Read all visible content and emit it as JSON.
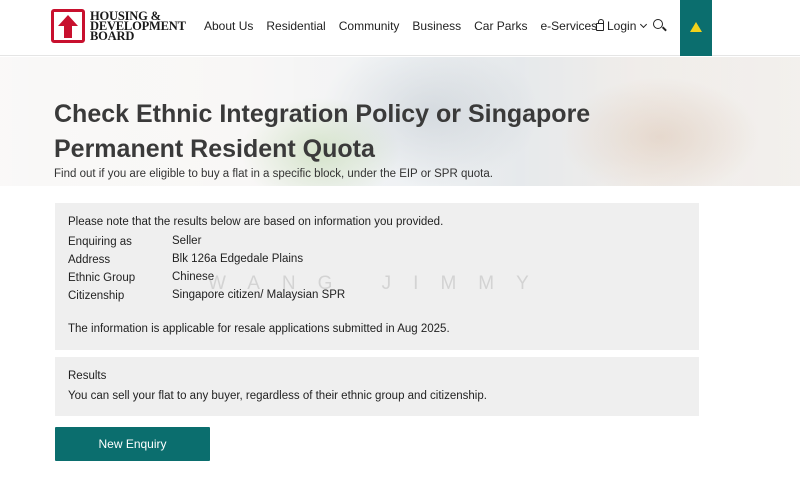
{
  "header": {
    "logo_lines": [
      "HOUSING &",
      "DEVELOPMENT",
      "BOARD"
    ],
    "nav": [
      "About Us",
      "Residential",
      "Community",
      "Business",
      "Car Parks",
      "e-Services"
    ],
    "login_label": "Login",
    "accent_color": "#0b6e6e",
    "brand_color": "#c8102e",
    "icons": [
      "house-logo-icon",
      "lock-icon",
      "chevron-down-icon",
      "search-icon",
      "warning-icon"
    ]
  },
  "hero": {
    "title": "Check Ethnic Integration Policy or Singapore Permanent Resident Quota",
    "subtitle": "Find out if you are eligible to buy a flat in a specific block, under the EIP or SPR quota."
  },
  "info": {
    "note": "Please note that the results below are based on information you provided.",
    "rows": [
      {
        "label": "Enquiring as",
        "value": "Seller"
      },
      {
        "label": "Address",
        "value": "Blk 126a Edgedale Plains"
      },
      {
        "label": "Ethnic Group",
        "value": "Chinese"
      },
      {
        "label": "Citizenship",
        "value": "Singapore citizen/ Malaysian SPR"
      }
    ],
    "applicable": "The information is applicable for resale applications submitted in Aug 2025."
  },
  "watermark": "WANG JIMMY",
  "results": {
    "title": "Results",
    "text": "You can sell your flat to any buyer, regardless of their ethnic group and citizenship."
  },
  "actions": {
    "new_enquiry_label": "New Enquiry"
  }
}
